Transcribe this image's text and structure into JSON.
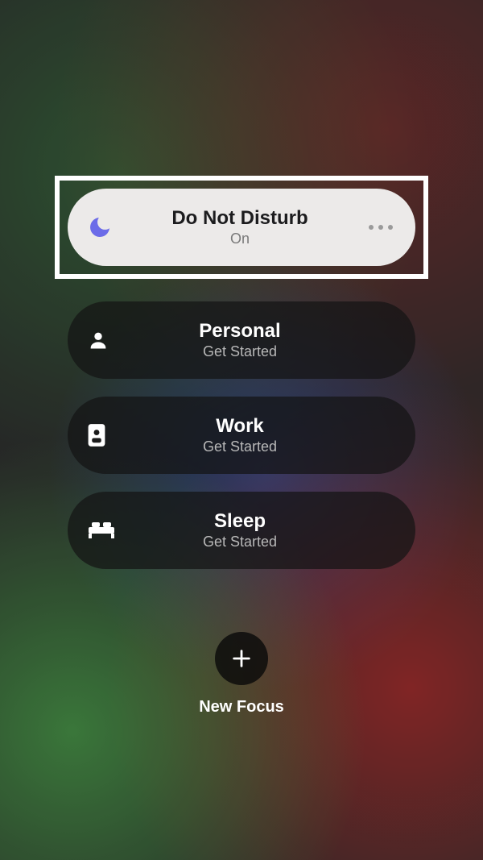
{
  "focus": {
    "dnd": {
      "title": "Do Not Disturb",
      "status": "On"
    },
    "personal": {
      "title": "Personal",
      "status": "Get Started"
    },
    "work": {
      "title": "Work",
      "status": "Get Started"
    },
    "sleep": {
      "title": "Sleep",
      "status": "Get Started"
    }
  },
  "newFocus": {
    "label": "New Focus"
  },
  "colors": {
    "moon": "#6b6be8"
  }
}
